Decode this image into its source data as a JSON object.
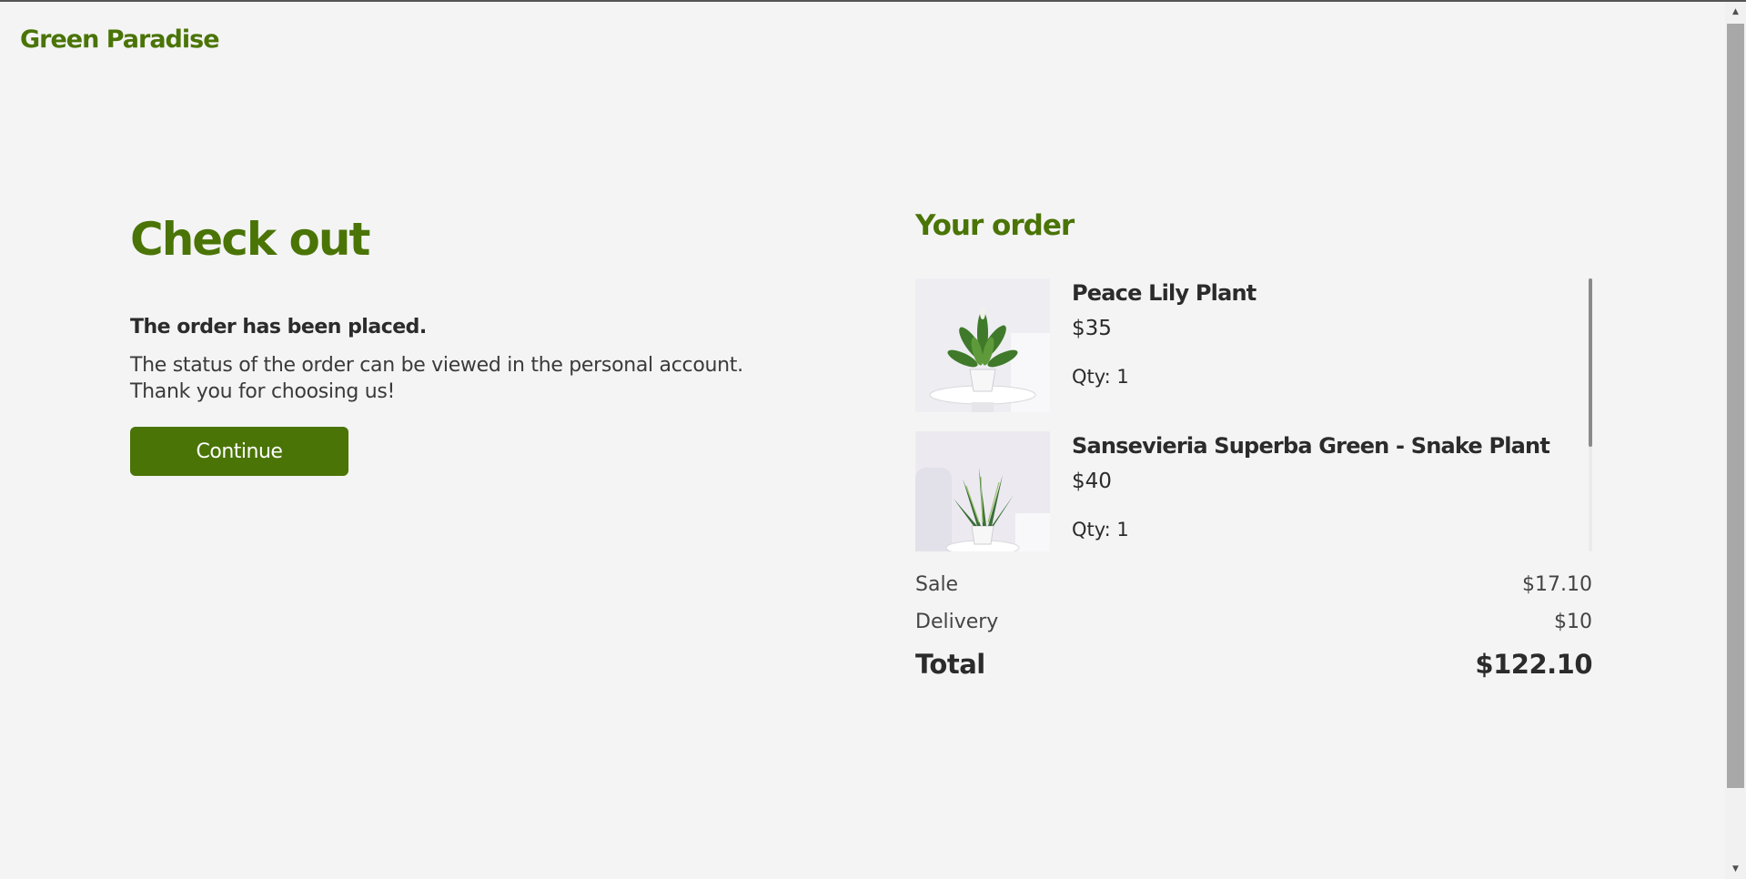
{
  "brand": {
    "logo_text": "Green Paradise",
    "accent_color": "#4a7406"
  },
  "checkout": {
    "title": "Check out",
    "placed_message": "The order has been placed.",
    "status_line_1": "The status of the order can be viewed in the personal account.",
    "status_line_2": "Thank you for choosing us!",
    "continue_label": "Continue"
  },
  "order": {
    "title": "Your order",
    "items": [
      {
        "name": "Peace Lily Plant",
        "price": "$35",
        "qty": "Qty: 1",
        "image_icon": "peace-lily-plant-image"
      },
      {
        "name": "Sansevieria Superba Green - Snake Plant",
        "price": "$40",
        "qty": "Qty: 1",
        "image_icon": "snake-plant-image"
      }
    ],
    "summary": {
      "sale_label": "Sale",
      "sale_value": "$17.10",
      "delivery_label": "Delivery",
      "delivery_value": "$10",
      "total_label": "Total",
      "total_value": "$122.10"
    }
  }
}
